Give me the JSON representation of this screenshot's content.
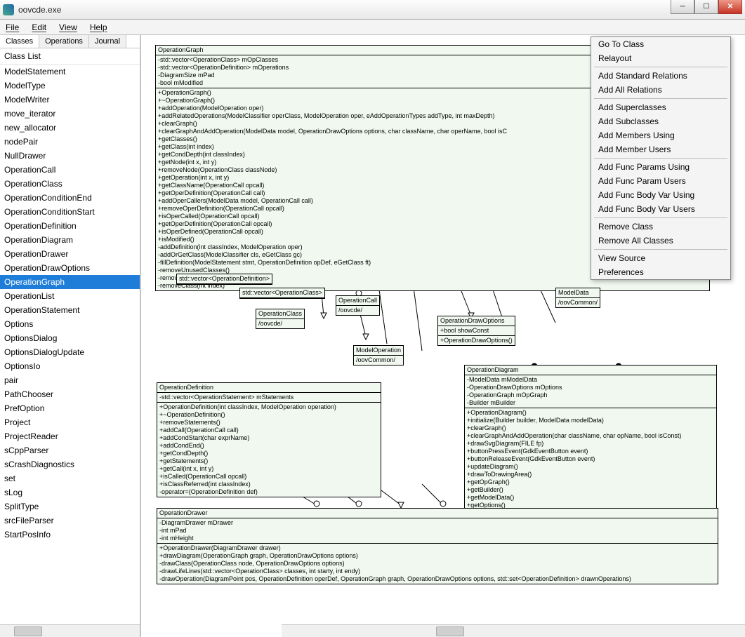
{
  "window": {
    "title": "oovcde.exe"
  },
  "menu": [
    "File",
    "Edit",
    "View",
    "Help"
  ],
  "sidebar": {
    "tabs": [
      "Classes",
      "Operations",
      "Journal"
    ],
    "header": "Class List",
    "items": [
      "ModelStatement",
      "ModelType",
      "ModelWriter",
      "move_iterator",
      "new_allocator",
      "nodePair",
      "NullDrawer",
      "OperationCall",
      "OperationClass",
      "OperationConditionEnd",
      "OperationConditionStart",
      "OperationDefinition",
      "OperationDiagram",
      "OperationDrawer",
      "OperationDrawOptions",
      "OperationGraph",
      "OperationList",
      "OperationStatement",
      "Options",
      "OptionsDialog",
      "OptionsDialogUpdate",
      "OptionsIo",
      "pair",
      "PathChooser",
      "PrefOption",
      "Project",
      "ProjectReader",
      "sCppParser",
      "sCrashDiagnostics",
      "set",
      "sLog",
      "SplitType",
      "srcFileParser",
      "StartPosInfo"
    ],
    "selected": "OperationGraph"
  },
  "contextMenu": {
    "groups": [
      [
        "Go To Class",
        "Relayout"
      ],
      [
        "Add Standard Relations",
        "Add All Relations"
      ],
      [
        "Add Superclasses",
        "Add Subclasses",
        "Add Members Using",
        "Add Member Users"
      ],
      [
        "Add Func Params Using",
        "Add Func Param Users",
        "Add Func Body Var Using",
        "Add Func Body Var Users"
      ],
      [
        "Remove Class",
        "Remove All Classes"
      ],
      [
        "View Source",
        "Preferences"
      ]
    ]
  },
  "boxes": {
    "opGraph": {
      "title": "OperationGraph",
      "attrs": [
        "-std::vector<OperationClass> mOpClasses",
        "-std::vector<OperationDefinition> mOperations",
        "-DiagramSize mPad",
        "-bool mModified"
      ],
      "ops": [
        "+OperationGraph()",
        "+~OperationGraph()",
        "+addOperation(ModelOperation oper)",
        "+addRelatedOperations(ModelClassifier operClass, ModelOperation oper, eAddOperationTypes addType, int maxDepth)",
        "+clearGraph()",
        "+clearGraphAndAddOperation(ModelData model, OperationDrawOptions options, char className, char operName, bool isC",
        "+getClasses()",
        "+getClass(int index)",
        "+getCondDepth(int classIndex)",
        "+getNode(int x, int y)",
        "+removeNode(OperationClass classNode)",
        "+getOperation(int x, int y)",
        "+getClassName(OperationCall opcall)",
        "+getOperDefinition(OperationCall call)",
        "+addOperCallers(ModelData model, OperationCall call)",
        "+removeOperDefinition(OperationCall opcall)",
        "+isOperCalled(OperationCall opcall)",
        "+getOperDefinition(OperationCall opcall)",
        "+isOperDefined(OperationCall opcall)",
        "+isModified()",
        "-addDefinition(int classIndex, ModelOperation oper)",
        "-addOrGetClass(ModelClassifier cls, eGetClass gc)",
        "-fillDefinition(ModelStatement stmt, OperationDefinition opDef, eGetClass ft)",
        "-removeUnusedClasses()",
        "-removeOperation(int index)",
        "-removeClass(int index)"
      ]
    },
    "vecOpDef": {
      "title": "std::vector<OperationDefinition>"
    },
    "vecOpClass": {
      "title": "std::vector<OperationClass>"
    },
    "opClass": {
      "title": "OperationClass",
      "attrs": [
        "/oovcde/"
      ]
    },
    "opCall": {
      "title": "OperationCall",
      "attrs": [
        "/oovcde/"
      ]
    },
    "modelOp": {
      "title": "ModelOperation",
      "attrs": [
        "/oovCommon/"
      ]
    },
    "modelData": {
      "title": "ModelData",
      "attrs": [
        "/oovCommon/"
      ]
    },
    "drawOpts": {
      "title": "OperationDrawOptions",
      "attrs": [
        "+bool showConst"
      ],
      "ops": [
        "+OperationDrawOptions()"
      ]
    },
    "opDef": {
      "title": "OperationDefinition",
      "attrs": [
        "-std::vector<OperationStatement> mStatements"
      ],
      "ops": [
        "+OperationDefinition(int classIndex, ModelOperation operation)",
        "+~OperationDefinition()",
        "+removeStatements()",
        "+addCall(OperationCall call)",
        "+addCondStart(char exprName)",
        "+addCondEnd()",
        "+getCondDepth()",
        "+getStatements()",
        "+getCall(int x, int y)",
        "+isCalled(OperationCall opcall)",
        "+isClassReferred(int classIndex)",
        "-operator=(OperationDefinition def)"
      ]
    },
    "opDiag": {
      "title": "OperationDiagram",
      "attrs": [
        "-ModelData mModelData",
        "-OperationDrawOptions mOptions",
        "-OperationGraph mOpGraph",
        "-Builder mBuilder"
      ],
      "ops": [
        "+OperationDiagram()",
        "+initialize(Builder builder, ModelData modelData)",
        "+clearGraph()",
        "+clearGraphAndAddOperation(char className, char opName, bool isConst)",
        "+drawSvgDiagram(FILE fp)",
        "+buttonPressEvent(GdkEventButton event)",
        "+buttonReleaseEvent(GdkEventButton event)",
        "+updateDiagram()",
        "+drawToDrawingArea()",
        "+getOpGraph()",
        "+getBuilder()",
        "+getModelData()",
        "+getOptions()"
      ]
    },
    "opDrawer": {
      "title": "OperationDrawer",
      "attrs": [
        "-DiagramDrawer mDrawer",
        "-int mPad",
        "-int mHeight"
      ],
      "ops": [
        "+OperationDrawer(DiagramDrawer drawer)",
        "+drawDiagram(OperationGraph graph, OperationDrawOptions options)",
        "-drawClass(OperationClass node, OperationDrawOptions options)",
        "-drawLifeLines(std::vector<OperationClass> classes, int starty, int endy)",
        "-drawOperation(DiagramPoint pos, OperationDefinition operDef, OperationGraph graph, OperationDrawOptions options, std::set<OperationDefinition> drawnOperations)"
      ]
    }
  }
}
